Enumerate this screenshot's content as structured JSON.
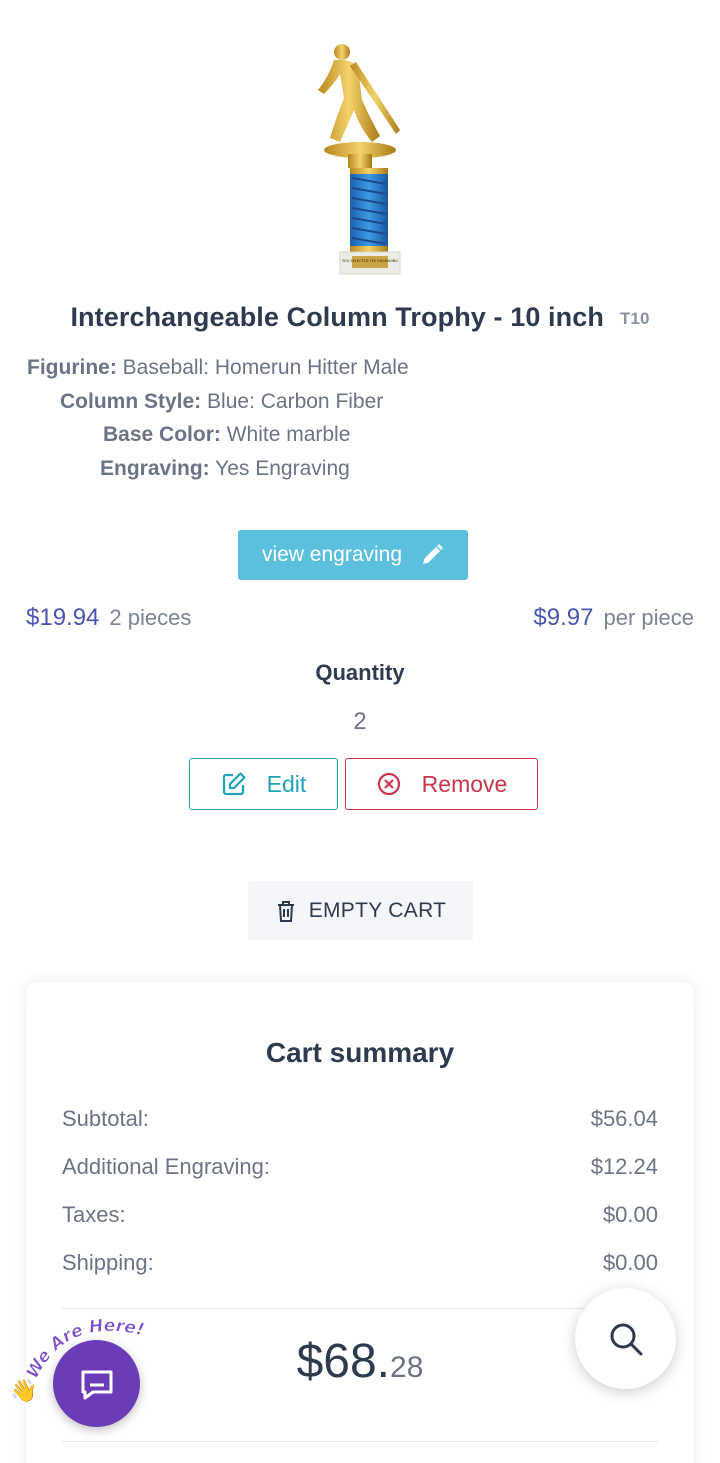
{
  "product": {
    "title": "Interchangeable Column Trophy - 10 inch",
    "sku": "T10",
    "trophy_plate_text": "YOU SELECTED YES ENGRAVING",
    "options": [
      {
        "label": "Figurine:",
        "value": "Baseball: Homerun Hitter Male"
      },
      {
        "label": "Column Style:",
        "value": "Blue: Carbon Fiber"
      },
      {
        "label": "Base Color:",
        "value": "White marble"
      },
      {
        "label": "Engraving:",
        "value": "Yes Engraving"
      }
    ],
    "view_engraving_label": "view engraving",
    "total_price": "$19.94",
    "pieces": "2 pieces",
    "unit_price": "$9.97",
    "per_piece": "per piece",
    "quantity_label": "Quantity",
    "quantity_value": "2",
    "edit_label": "Edit",
    "remove_label": "Remove"
  },
  "empty_cart_label": "EMPTY CART",
  "summary": {
    "title": "Cart summary",
    "rows": [
      {
        "label": "Subtotal:",
        "value": "$56.04"
      },
      {
        "label": "Additional Engraving:",
        "value": "$12.24"
      },
      {
        "label": "Taxes:",
        "value": "$0.00"
      },
      {
        "label": "Shipping:",
        "value": "$0.00"
      }
    ],
    "total_main": "$68.",
    "total_cents": "28"
  },
  "chat_widget": {
    "badge_text": "We Are Here!",
    "wave_emoji": "👋"
  },
  "colors": {
    "price": "#4a55b0",
    "info_button": "#5bc0de",
    "edit": "#20a3b8",
    "remove": "#c9354a",
    "chat": "#6a3cb8"
  }
}
